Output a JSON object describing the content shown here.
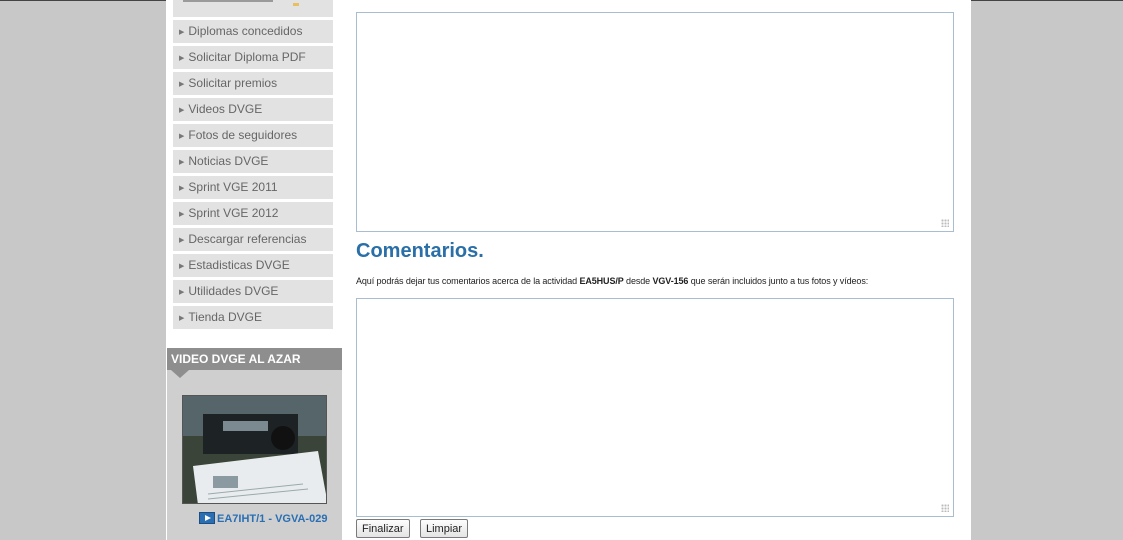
{
  "sidebar": {
    "menu": [
      {
        "label": "Diplomas concedidos"
      },
      {
        "label": "Solicitar Diploma PDF"
      },
      {
        "label": "Solicitar premios"
      },
      {
        "label": "Videos DVGE"
      },
      {
        "label": "Fotos de seguidores"
      },
      {
        "label": "Noticias DVGE"
      },
      {
        "label": "Sprint VGE 2011"
      },
      {
        "label": "Sprint VGE 2012"
      },
      {
        "label": "Descargar referencias"
      },
      {
        "label": "Estadisticas DVGE"
      },
      {
        "label": "Utilidades DVGE"
      },
      {
        "label": "Tienda DVGE"
      }
    ],
    "video": {
      "header": "VIDEO DVGE AL AZAR",
      "caption": "EA7IHT/1 - VGVA-029",
      "icon": "video-clap-icon"
    }
  },
  "main": {
    "comments_title": "Comentarios.",
    "intro": {
      "prefix": "Aquí podrás dejar tus comentarios acerca de la actividad ",
      "callsign": "EA5HUS/P",
      "middle": " desde ",
      "reference": "VGV-156",
      "suffix": " que serán incluidos junto a tus fotos y vídeos:"
    },
    "buttons": {
      "submit": "Finalizar",
      "reset": "Limpiar"
    }
  },
  "colors": {
    "accent": "#2a6fa8",
    "menu_bg": "#e2e2e2",
    "page_bg": "#c8c8c8"
  }
}
